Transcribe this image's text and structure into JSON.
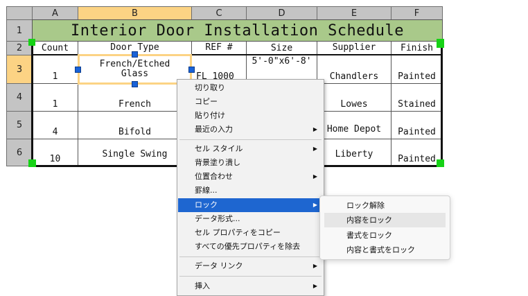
{
  "sheet": {
    "columns": [
      "A",
      "B",
      "C",
      "D",
      "E",
      "F"
    ],
    "rows": [
      "1",
      "2",
      "3",
      "4",
      "5",
      "6"
    ],
    "title": "Interior Door Installation Schedule",
    "headers": [
      "Count",
      "Door Type",
      "REF #",
      "Size",
      "Supplier",
      "Finish"
    ],
    "data": [
      [
        "1",
        "French/Etched Glass",
        "FL 1000",
        "5'-0\"x6'-8'",
        "Chandlers",
        "Painted"
      ],
      [
        "1",
        "French",
        "",
        "",
        "Lowes",
        "Stained"
      ],
      [
        "4",
        "Bifold",
        "",
        "",
        "Home Depot",
        "Painted"
      ],
      [
        "10",
        "Single Swing",
        "",
        "",
        "Liberty",
        "Painted"
      ]
    ],
    "title_bg": "#a9c98a",
    "selected_header_bg": "#fcd384"
  },
  "menu": {
    "items": [
      {
        "label": "切り取り"
      },
      {
        "label": "コピー"
      },
      {
        "label": "貼り付け"
      },
      {
        "label": "最近の入力",
        "submenu": true
      },
      {
        "label": "セル スタイル",
        "submenu": true
      },
      {
        "label": "背景塗り潰し"
      },
      {
        "label": "位置合わせ",
        "submenu": true
      },
      {
        "label": "罫線..."
      },
      {
        "label": "ロック",
        "submenu": true,
        "highlighted": true
      },
      {
        "label": "データ形式..."
      },
      {
        "label": "セル プロパティをコピー"
      },
      {
        "label": "すべての優先プロパティを除去"
      },
      {
        "label": "データ リンク",
        "submenu": true
      },
      {
        "label": "挿入",
        "submenu": true
      }
    ],
    "highlight_color": "#1e66d0"
  },
  "submenu": {
    "items": [
      {
        "label": "ロック解除"
      },
      {
        "label": "内容をロック",
        "hovered": true
      },
      {
        "label": "書式をロック"
      },
      {
        "label": "内容と書式をロック"
      }
    ]
  }
}
